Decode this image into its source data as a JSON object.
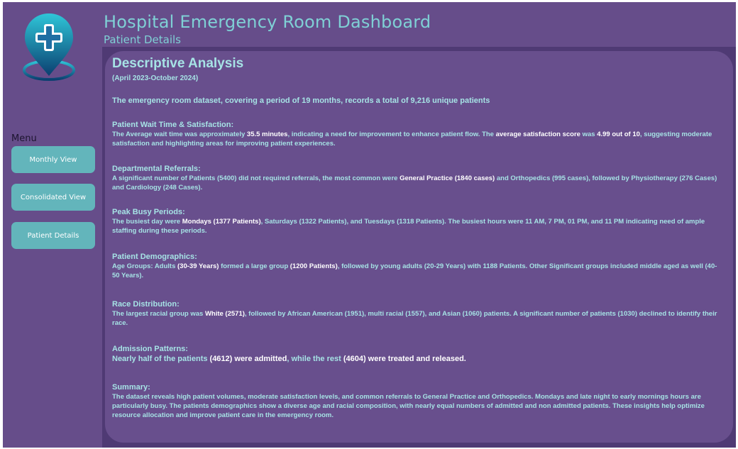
{
  "header": {
    "title": "Hospital Emergency Room Dashboard",
    "subtitle": "Patient Details"
  },
  "sidebar": {
    "menu_label": "Menu",
    "items": [
      {
        "label": "Monthly View"
      },
      {
        "label": "Consolidated View"
      },
      {
        "label": "Patient Details"
      }
    ]
  },
  "colors": {
    "background": "#664d8a",
    "card": "#684f8d",
    "accent_teal": "#63b5bb",
    "text_teal": "#a6e3e5",
    "logo_top": "#2fc6d8",
    "logo_bottom": "#0b3f70"
  },
  "icons": {
    "logo": "map-pin-medical-cross-icon"
  },
  "analysis": {
    "title": "Descriptive Analysis",
    "period": "(April 2023-October 2024)",
    "intro": "The emergency room dataset, covering a period of 19 months, records a total of 9,216 unique patients",
    "wait": {
      "heading": "Patient Wait Time & Satisfaction:",
      "t1": "The Average wait time was approximately ",
      "b1": "35.5 minutes",
      "t2": ", indicating a need for improvement to enhance patient flow. The ",
      "b2": "average satisfaction score",
      "t3": " was ",
      "b3": "4.99 out of 10",
      "t4": ", suggesting moderate satisfaction and highlighting areas for improving patient experiences."
    },
    "referrals": {
      "heading": "Departmental Referrals:",
      "t1": "A significant number of Patients (5400) did not required referrals, the most common were ",
      "b1": "General Practice (1840 cases)",
      "t2": " and Orthopedics (995 cases), followed by Physiotherapy (276 Cases) and Cardiology (248 Cases)."
    },
    "peak": {
      "heading": "Peak Busy Periods:",
      "t1": "The busiest day were ",
      "b1": "Mondays (1377 Patients)",
      "t2": ", Saturdays (1322 Patients), and Tuesdays (1318 Patients). The busiest hours were 11 AM, 7 PM, 01 PM, and 11 PM indicating need of ample staffing during these periods."
    },
    "demographics": {
      "heading": "Patient Demographics:",
      "t1": "Age Groups: Adults ",
      "b1": "(30-39 Years)",
      "t2": " formed a large group ",
      "b2": "(1200 Patients)",
      "t3": ", followed by young adults (20-29 Years) with 1188 Patients. Other Significant groups included middle aged as well (40-50 Years)."
    },
    "race": {
      "heading": "Race Distribution:",
      "t1": "The largest racial group was ",
      "b1": "White (2571)",
      "t2": ", followed by African American (1951), multi racial (1557), and Asian (1060) patients. A significant number of patients (1030) declined to identify their race."
    },
    "admission": {
      "heading": "Admission Patterns:",
      "t1": "Nearly half of the patients ",
      "b1": "(4612) were admitted",
      "t2": ", while the rest ",
      "b2": "(4604) were treated and released."
    },
    "summary": {
      "heading": "Summary:",
      "text": "The dataset reveals high patient volumes, moderate satisfaction levels, and common referrals to General Practice and Orthopedics. Mondays and late night to early mornings hours are particularly busy. The patients demographics show a diverse age and racial composition, with nearly equal numbers of admitted and non admitted patients. These insights help optimize resource allocation and improve patient care in the emergency room."
    }
  }
}
